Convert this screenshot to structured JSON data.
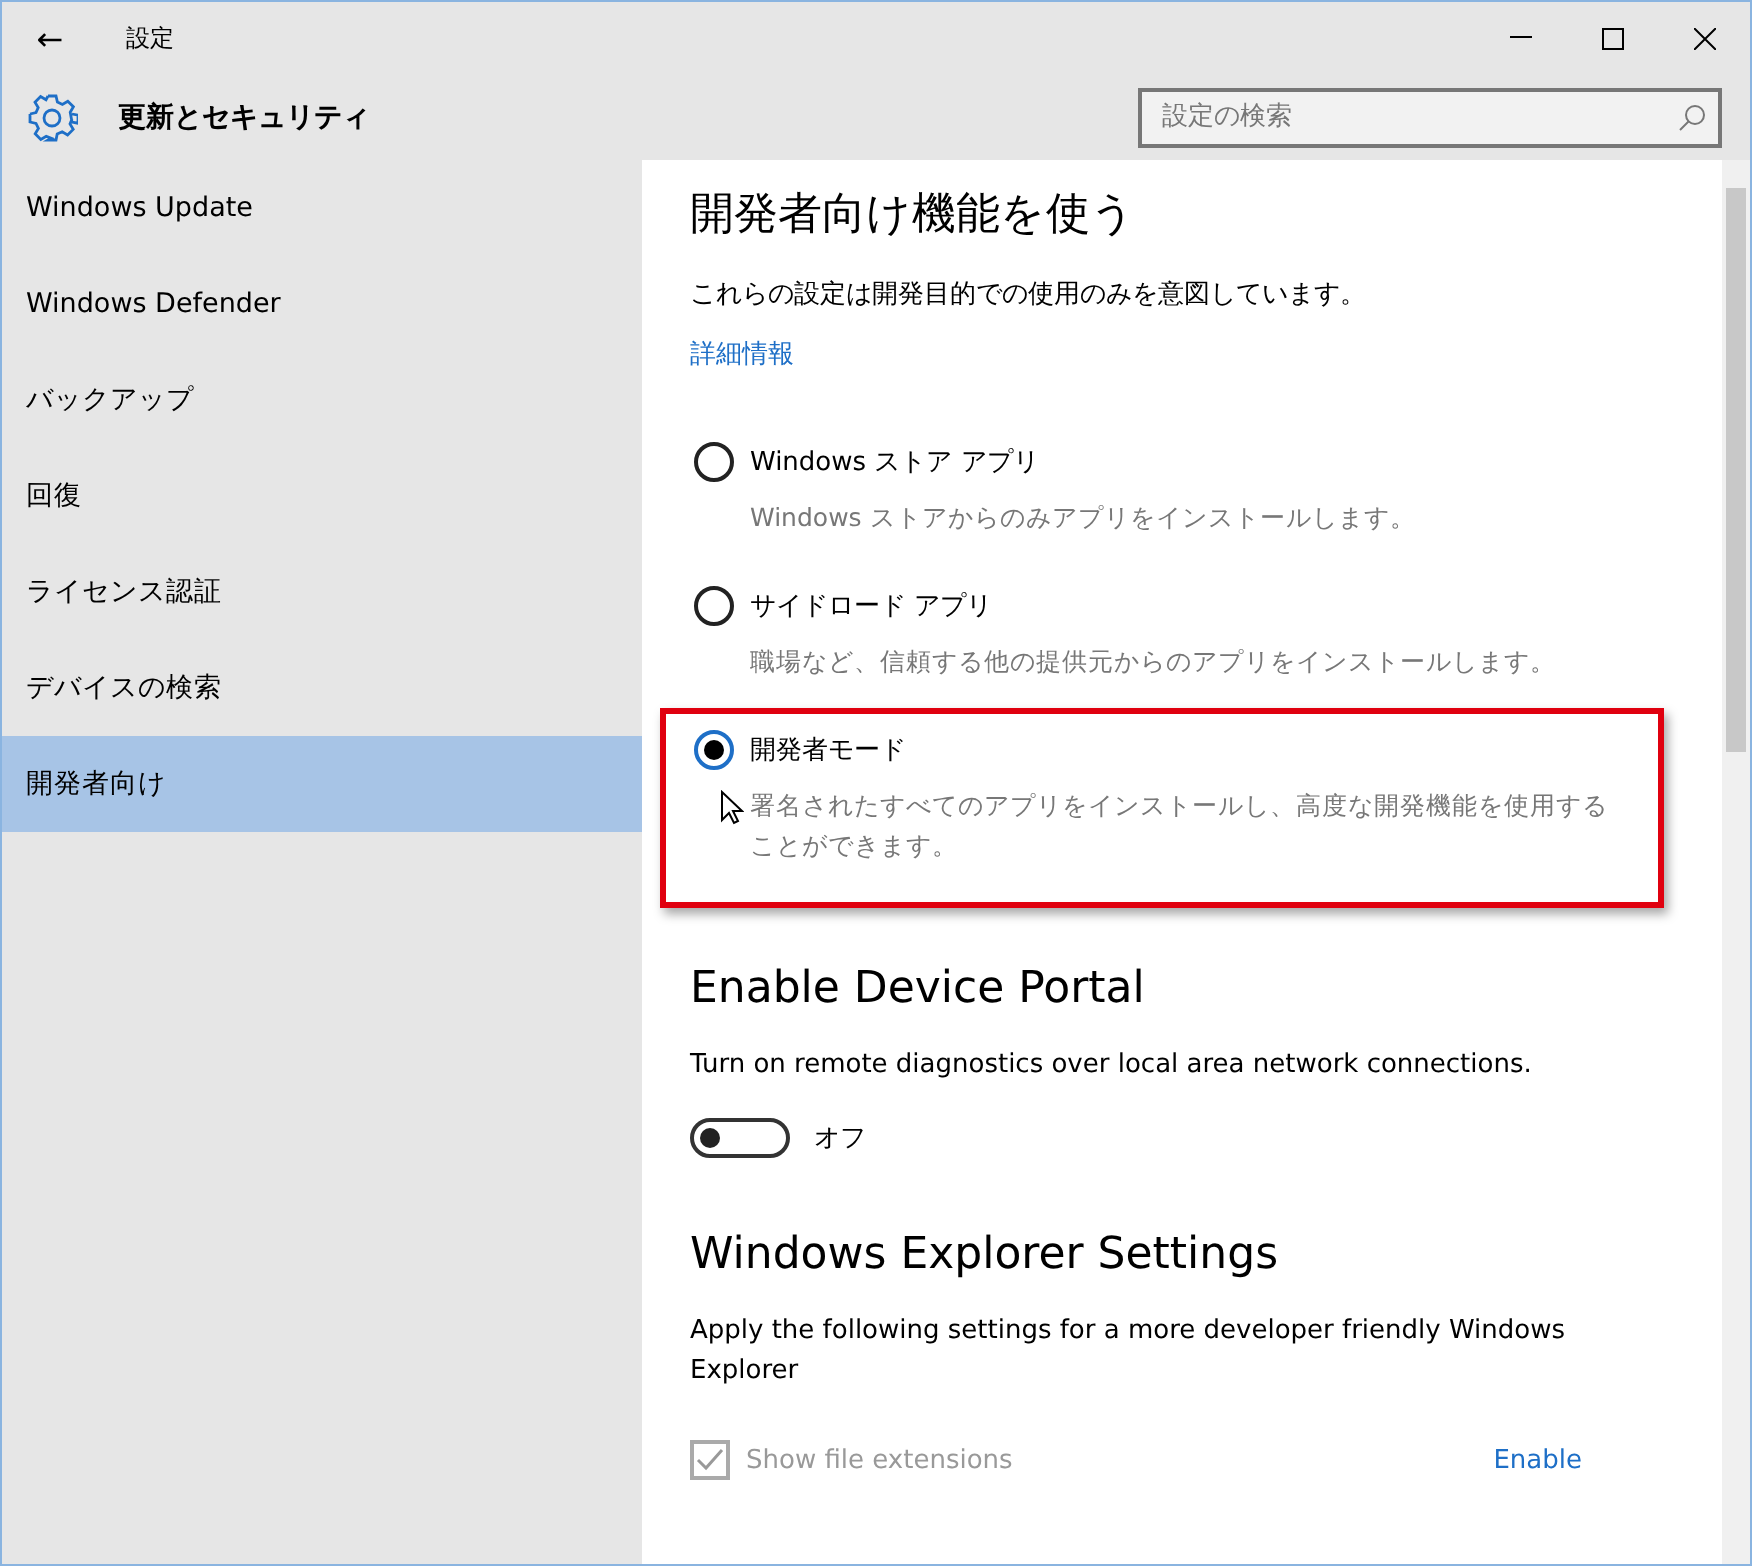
{
  "window": {
    "title": "設定",
    "back": "←"
  },
  "header": {
    "title": "更新とセキュリティ",
    "search": {
      "placeholder": "設定の検索"
    }
  },
  "sidebar": {
    "items": [
      {
        "label": "Windows Update",
        "selected": false
      },
      {
        "label": "Windows Defender",
        "selected": false
      },
      {
        "label": "バックアップ",
        "selected": false
      },
      {
        "label": "回復",
        "selected": false
      },
      {
        "label": "ライセンス認証",
        "selected": false
      },
      {
        "label": "デバイスの検索",
        "selected": false
      },
      {
        "label": "開発者向け",
        "selected": true
      }
    ]
  },
  "developer": {
    "heading": "開発者向け機能を使う",
    "description": "これらの設定は開発目的での使用のみを意図しています。",
    "link": "詳細情報",
    "options": [
      {
        "label": "Windows ストア アプリ",
        "description": "Windows ストアからのみアプリをインストールします。",
        "selected": false,
        "highlighted": false
      },
      {
        "label": "サイドロード アプリ",
        "description": "職場など、信頼する他の提供元からのアプリをインストールします。",
        "selected": false,
        "highlighted": false
      },
      {
        "label": "開発者モード",
        "description": "署名されたすべてのアプリをインストールし、高度な開発機能を使用することができます。",
        "selected": true,
        "highlighted": true
      }
    ]
  },
  "device_portal": {
    "heading": "Enable Device Portal",
    "description": "Turn on remote diagnostics over local area network connections.",
    "toggle": {
      "on": false,
      "label": "オフ"
    }
  },
  "explorer": {
    "heading": "Windows Explorer Settings",
    "description": "Apply the following settings for a more developer friendly Windows Explorer",
    "settings": [
      {
        "label": "Show file extensions",
        "checked": true,
        "disabled": true,
        "action": "Enable"
      }
    ]
  }
}
